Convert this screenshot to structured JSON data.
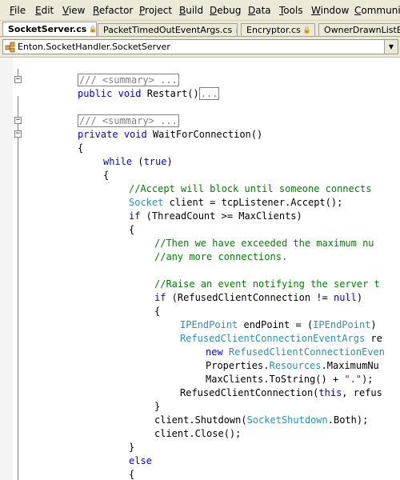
{
  "menubar": {
    "items": [
      {
        "label": "File",
        "mnemonic": "F",
        "rest": "ile"
      },
      {
        "label": "Edit",
        "mnemonic": "E",
        "rest": "dit"
      },
      {
        "label": "View",
        "mnemonic": "V",
        "rest": "iew"
      },
      {
        "label": "Refactor",
        "mnemonic": "R",
        "rest": "efactor"
      },
      {
        "label": "Project",
        "mnemonic": "P",
        "rest": "roject"
      },
      {
        "label": "Build",
        "mnemonic": "B",
        "rest": "uild"
      },
      {
        "label": "Debug",
        "mnemonic": "D",
        "rest": "ebug"
      },
      {
        "label": "Data",
        "mnemonic": "D",
        "rest": "ata"
      },
      {
        "label": "Tools",
        "mnemonic": "T",
        "rest": "ools"
      },
      {
        "label": "Window",
        "mnemonic": "W",
        "rest": "indow"
      },
      {
        "label": "Community",
        "mnemonic": "C",
        "rest": "ommunity"
      }
    ]
  },
  "tabs": [
    {
      "label": "SocketServer.cs",
      "active": true,
      "lock": "🔒"
    },
    {
      "label": "PacketTimedOutEventArgs.cs",
      "active": false,
      "lock": "🔒"
    },
    {
      "label": "Encryptor.cs",
      "active": false,
      "lock": "🔒"
    },
    {
      "label": "OwnerDrawnListBox",
      "active": false,
      "lock": ""
    }
  ],
  "navigation": {
    "class_path": "Enton.SocketHandler.SocketServer",
    "icon": "class-icon",
    "dropdown_glyph": "▼"
  },
  "outline_toggles": [
    "−",
    "−",
    "−"
  ],
  "code_lines": [
    {
      "indent": 0,
      "tokens": [
        {
          "t": "/// <summary> ...",
          "c": "collapsed"
        }
      ]
    },
    {
      "indent": 0,
      "tokens": [
        {
          "t": "public",
          "c": "kw"
        },
        {
          "t": " "
        },
        {
          "t": "void",
          "c": "kw"
        },
        {
          "t": " Restart()"
        },
        {
          "t": "...",
          "c": "collapsed"
        }
      ]
    },
    {
      "indent": 0,
      "tokens": []
    },
    {
      "indent": 0,
      "tokens": [
        {
          "t": "/// <summary> ...",
          "c": "collapsed"
        }
      ]
    },
    {
      "indent": 0,
      "tokens": [
        {
          "t": "private",
          "c": "kw"
        },
        {
          "t": " "
        },
        {
          "t": "void",
          "c": "kw"
        },
        {
          "t": " WaitForConnection()"
        }
      ]
    },
    {
      "indent": 0,
      "tokens": [
        {
          "t": "{"
        }
      ]
    },
    {
      "indent": 1,
      "tokens": [
        {
          "t": "while",
          "c": "kw"
        },
        {
          "t": " ("
        },
        {
          "t": "true",
          "c": "kw"
        },
        {
          "t": ")"
        }
      ]
    },
    {
      "indent": 1,
      "tokens": [
        {
          "t": "{"
        }
      ]
    },
    {
      "indent": 2,
      "tokens": [
        {
          "t": "//Accept will block until someone connects",
          "c": "cm"
        }
      ]
    },
    {
      "indent": 2,
      "tokens": [
        {
          "t": "Socket",
          "c": "ty"
        },
        {
          "t": " client = tcpListener.Accept();"
        }
      ]
    },
    {
      "indent": 2,
      "tokens": [
        {
          "t": "if",
          "c": "kw"
        },
        {
          "t": " (ThreadCount >= MaxClients)"
        }
      ]
    },
    {
      "indent": 2,
      "tokens": [
        {
          "t": "{"
        }
      ]
    },
    {
      "indent": 3,
      "tokens": [
        {
          "t": "//Then we have exceeded the maximum nu",
          "c": "cm"
        }
      ]
    },
    {
      "indent": 3,
      "tokens": [
        {
          "t": "//any more connections.",
          "c": "cm"
        }
      ]
    },
    {
      "indent": 0,
      "tokens": []
    },
    {
      "indent": 3,
      "tokens": [
        {
          "t": "//Raise an event notifying the server t",
          "c": "cm"
        }
      ]
    },
    {
      "indent": 3,
      "tokens": [
        {
          "t": "if",
          "c": "kw"
        },
        {
          "t": " (RefusedClientConnection != "
        },
        {
          "t": "null",
          "c": "kw"
        },
        {
          "t": ")"
        }
      ]
    },
    {
      "indent": 3,
      "tokens": [
        {
          "t": "{"
        }
      ]
    },
    {
      "indent": 4,
      "tokens": [
        {
          "t": "IPEndPoint",
          "c": "ty"
        },
        {
          "t": " endPoint = ("
        },
        {
          "t": "IPEndPoint",
          "c": "ty"
        },
        {
          "t": ")"
        }
      ]
    },
    {
      "indent": 4,
      "tokens": [
        {
          "t": "RefusedClientConnectionEventArgs",
          "c": "ty"
        },
        {
          "t": " re"
        }
      ]
    },
    {
      "indent": 5,
      "tokens": [
        {
          "t": "new",
          "c": "kw"
        },
        {
          "t": " "
        },
        {
          "t": "RefusedClientConnectionEven",
          "c": "ty"
        }
      ]
    },
    {
      "indent": 5,
      "tokens": [
        {
          "t": "Properties."
        },
        {
          "t": "Resources",
          "c": "ty"
        },
        {
          "t": ".MaximumNu"
        }
      ]
    },
    {
      "indent": 5,
      "tokens": [
        {
          "t": "MaxClients.ToString() + "
        },
        {
          "t": "\".\"",
          "c": "st"
        },
        {
          "t": ");"
        }
      ]
    },
    {
      "indent": 4,
      "tokens": [
        {
          "t": "RefusedClientConnection("
        },
        {
          "t": "this",
          "c": "kw"
        },
        {
          "t": ", refus"
        }
      ]
    },
    {
      "indent": 3,
      "tokens": [
        {
          "t": "}"
        }
      ]
    },
    {
      "indent": 3,
      "tokens": [
        {
          "t": "client.Shutdown("
        },
        {
          "t": "SocketShutdown",
          "c": "ty"
        },
        {
          "t": ".Both);"
        }
      ]
    },
    {
      "indent": 3,
      "tokens": [
        {
          "t": "client.Close();"
        }
      ]
    },
    {
      "indent": 2,
      "tokens": [
        {
          "t": "}"
        }
      ]
    },
    {
      "indent": 2,
      "tokens": [
        {
          "t": "else",
          "c": "kw"
        }
      ]
    },
    {
      "indent": 2,
      "tokens": [
        {
          "t": "{"
        }
      ]
    }
  ]
}
